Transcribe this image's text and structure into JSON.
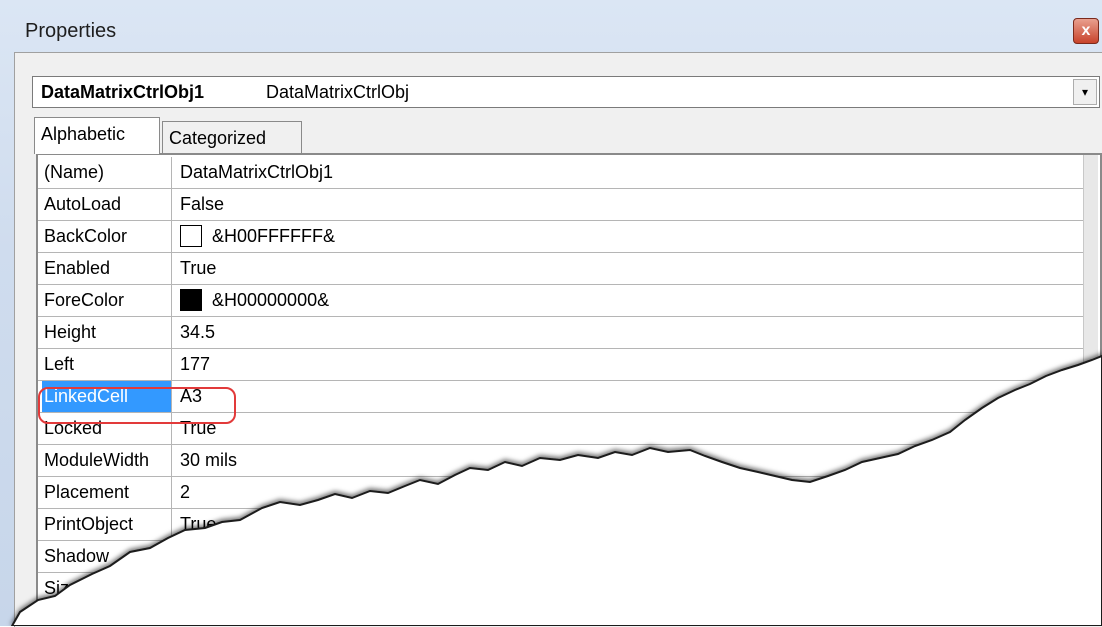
{
  "window": {
    "title": "Properties",
    "close_label": "x"
  },
  "object_selector": {
    "name": "DataMatrixCtrlObj1",
    "type": "DataMatrixCtrlObj",
    "dropdown_glyph": "▾"
  },
  "tabs": [
    {
      "label": "Alphabetic",
      "active": true
    },
    {
      "label": "Categorized",
      "active": false
    }
  ],
  "properties": [
    {
      "name": "(Name)",
      "value": "DataMatrixCtrlObj1"
    },
    {
      "name": "AutoLoad",
      "value": "False"
    },
    {
      "name": "BackColor",
      "value": "&H00FFFFFF&",
      "swatch": "#ffffff"
    },
    {
      "name": "Enabled",
      "value": "True"
    },
    {
      "name": "ForeColor",
      "value": "&H00000000&",
      "swatch": "#000000"
    },
    {
      "name": "Height",
      "value": "34.5"
    },
    {
      "name": "Left",
      "value": "177"
    },
    {
      "name": "LinkedCell",
      "value": "A3",
      "selected": true
    },
    {
      "name": "Locked",
      "value": "True"
    },
    {
      "name": "ModuleWidth",
      "value": "30 mils"
    },
    {
      "name": "Placement",
      "value": "2"
    },
    {
      "name": "PrintObject",
      "value": "True"
    },
    {
      "name": "Shadow",
      "value": ""
    },
    {
      "name": "SizeI",
      "value": ""
    }
  ],
  "colors": {
    "selection": "#3399ff",
    "highlight_ring": "#e23a3a",
    "close_button": "#c8432b"
  }
}
